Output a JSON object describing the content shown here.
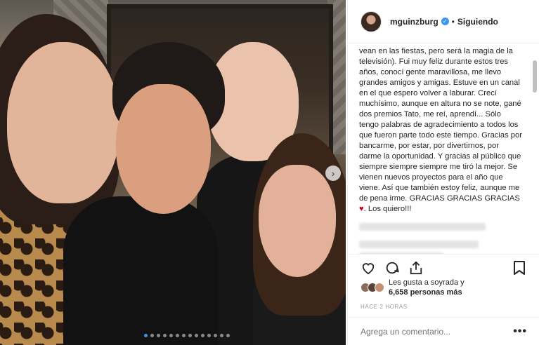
{
  "post": {
    "username": "mguinzburg",
    "verified_icon": "verified-badge-icon",
    "separator": "•",
    "follow_status": "Siguiendo",
    "caption": "vean en las fiestas, pero será la magia de la televisión). Fui muy feliz durante estos tres años, conocí gente maravillosa, me llevo grandes amigos y amigas. Estuve en un canal en el que espero volver a laburar. Crecí muchísimo, aunque en altura no se note, gané dos premios Tato, me reí, aprendí... Sólo tengo palabras de agradecimiento a todos los que fueron parte todo este tiempo. Gracias por bancarme, por estar, por divertirnos, por darme la oportunidad. Y gracias al público que siempre siempre siempre me tiró la mejor. Se vienen nuevos proyectos para el año que viene. Así que también estoy feliz, aunque me de pena irme. GRACIAS GRACIAS GRACIAS",
    "caption_heart": "♥",
    "caption_end": ". Los quiero!!!",
    "likes_line1": "Les gusta a soyrada y",
    "likes_line2": "6,658 personas más",
    "timestamp": "HACE 2 HORAS",
    "comment_placeholder": "Agrega un comentario...",
    "more_label": "•••",
    "next_label": "›"
  },
  "icons": {
    "like": "heart-outline-icon",
    "comment": "comment-bubble-icon",
    "share": "share-icon",
    "save": "bookmark-icon"
  },
  "colors": {
    "accent": "#3897f0",
    "heart": "#d0021b",
    "muted": "#999999"
  }
}
